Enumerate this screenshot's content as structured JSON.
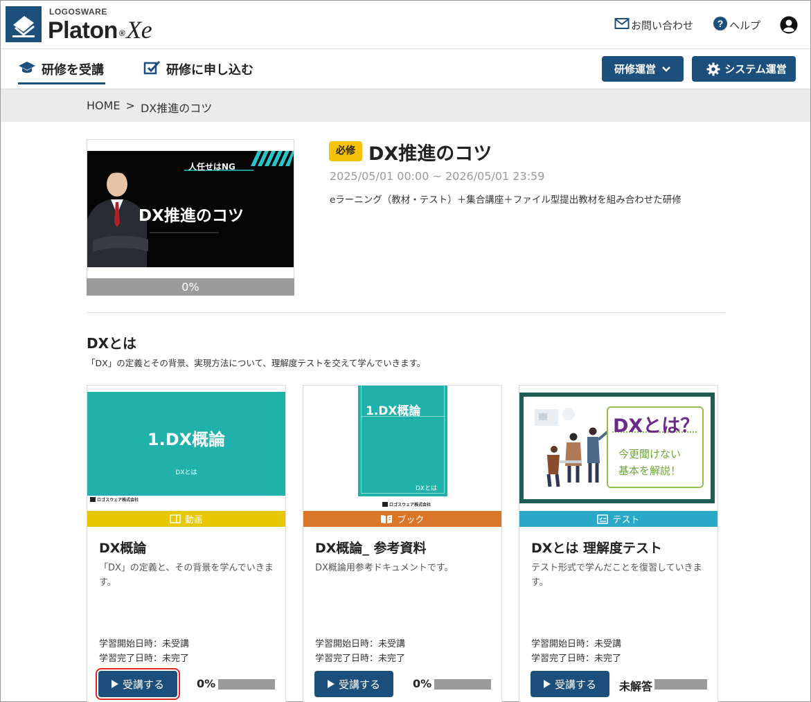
{
  "header": {
    "logo_small": "LOGOSWARE",
    "logo_big": "Platon",
    "logo_reg": "®",
    "logo_xe": "Xe",
    "contact_label": "お問い合わせ",
    "help_label": "ヘルプ"
  },
  "nav": {
    "take_training": "研修を受講",
    "apply_training": "研修に申し込む",
    "training_ops": "研修運営",
    "system_ops": "システム運営"
  },
  "breadcrumb": {
    "home": "HOME",
    "separator": ">",
    "current": "DX推進のコツ"
  },
  "course": {
    "badge": "必修",
    "title": "DX推進のコツ",
    "period": "2025/05/01 00:00 ~ 2026/05/01 23:59",
    "description": "eラーニング（教材・テスト）＋集合講座＋ファイル型提出教材を組み合わせた研修",
    "progress": "0%",
    "thumb_caption": "人任せはNG",
    "thumb_title": "DX推進のコツ"
  },
  "section": {
    "title": "DXとは",
    "description": "「DX」の定義とその背景、実現方法について、理解度テストを交えて学んでいきます。"
  },
  "colors": {
    "primary": "#1d4f7c",
    "badge": "#f5c20a",
    "video": "#e6c700",
    "book": "#d9762a",
    "test": "#2aa8c8",
    "teal": "#20b2aa",
    "highlight": "#e0262a"
  },
  "cards": [
    {
      "type_label": "動画",
      "type_icon": "video-icon",
      "title": "DX概論",
      "description": "「DX」の定義と、その背景を学んでいきます。",
      "start_label": "学習開始日時：未受講",
      "end_label": "学習完了日時：未完了",
      "button_label": "受講する",
      "progress": "0%",
      "thumb_title": "1.DX概論",
      "thumb_sub": "DXとは",
      "thumb_company": "ロゴスウェア株式会社"
    },
    {
      "type_label": "ブック",
      "type_icon": "book-icon",
      "title": "DX概論_ 参考資料",
      "description": "DX概論用参考ドキュメントです。",
      "start_label": "学習開始日時：未受講",
      "end_label": "学習完了日時：未完了",
      "button_label": "受講する",
      "progress": "0%",
      "thumb_title": "1.DX概論",
      "thumb_sub": "DXとは",
      "thumb_company": "ロゴスウェア株式会社"
    },
    {
      "type_label": "テスト",
      "type_icon": "test-icon",
      "title": "DXとは 理解度テスト",
      "description": "テスト形式で学んだことを復習していきます。",
      "start_label": "学習開始日時：未受講",
      "end_label": "学習完了日時：未完了",
      "button_label": "受講する",
      "progress": "未解答",
      "thumb_title": "DXとは？",
      "thumb_line1": "今更聞けない",
      "thumb_line2": "基本を解説！"
    }
  ]
}
